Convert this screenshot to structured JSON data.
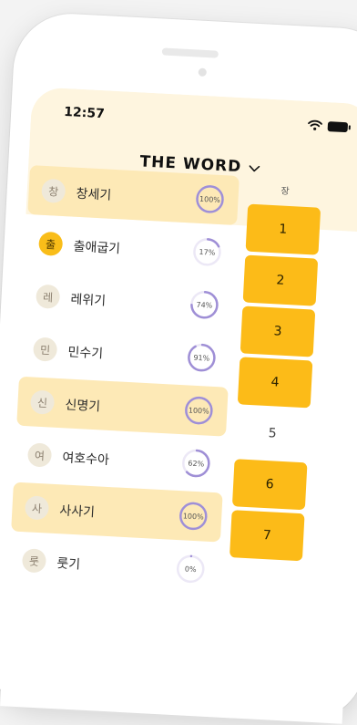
{
  "status_bar": {
    "time": "12:57"
  },
  "header": {
    "title": "THE WORD"
  },
  "chapter_column_label": "장",
  "books": [
    {
      "badge": "창",
      "name": "창세기",
      "progress_label": "100%",
      "progress": 100,
      "highlighted": true,
      "badge_active": false
    },
    {
      "badge": "출",
      "name": "출애굽기",
      "progress_label": "17%",
      "progress": 17,
      "highlighted": false,
      "badge_active": true
    },
    {
      "badge": "레",
      "name": "레위기",
      "progress_label": "74%",
      "progress": 74,
      "highlighted": false,
      "badge_active": false
    },
    {
      "badge": "민",
      "name": "민수기",
      "progress_label": "91%",
      "progress": 91,
      "highlighted": false,
      "badge_active": false
    },
    {
      "badge": "신",
      "name": "신명기",
      "progress_label": "100%",
      "progress": 100,
      "highlighted": true,
      "badge_active": false
    },
    {
      "badge": "여",
      "name": "여호수아",
      "progress_label": "62%",
      "progress": 62,
      "highlighted": false,
      "badge_active": false
    },
    {
      "badge": "사",
      "name": "사사기",
      "progress_label": "100%",
      "progress": 100,
      "highlighted": true,
      "badge_active": false
    },
    {
      "badge": "룻",
      "name": "룻기",
      "progress_label": "0%",
      "progress": 0,
      "highlighted": false,
      "badge_active": false
    }
  ],
  "chapters": [
    {
      "label": "1",
      "read": true
    },
    {
      "label": "2",
      "read": true
    },
    {
      "label": "3",
      "read": true
    },
    {
      "label": "4",
      "read": true
    },
    {
      "label": "5",
      "read": false
    },
    {
      "label": "6",
      "read": true
    },
    {
      "label": "7",
      "read": true
    }
  ],
  "colors": {
    "accent": "#fcbb18",
    "highlight_row": "#fde9b6",
    "header_bg": "#fef5df",
    "progress_ring": "#9f8fd6"
  }
}
